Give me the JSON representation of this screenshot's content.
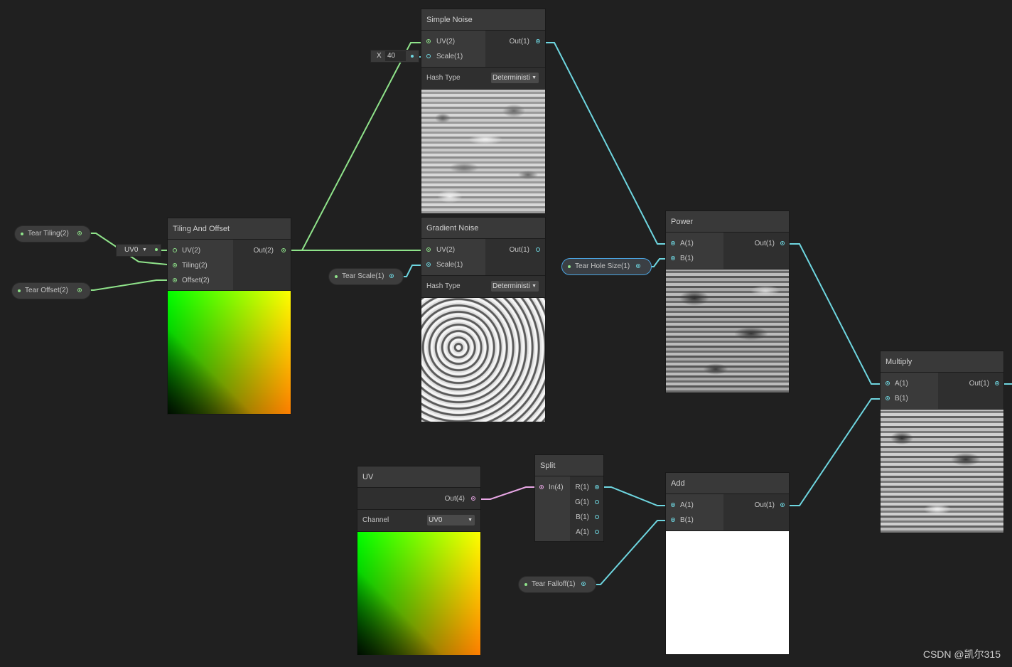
{
  "nodes": {
    "simple_noise": {
      "title": "Simple Noise",
      "inputs": [
        "UV(2)",
        "Scale(1)"
      ],
      "output": "Out(1)",
      "hash_label": "Hash Type",
      "hash_value": "Deterministi",
      "scale_field": {
        "axis": "X",
        "value": "40"
      }
    },
    "gradient_noise": {
      "title": "Gradient Noise",
      "inputs": [
        "UV(2)",
        "Scale(1)"
      ],
      "output": "Out(1)",
      "hash_label": "Hash Type",
      "hash_value": "Deterministi"
    },
    "tiling_offset": {
      "title": "Tiling And Offset",
      "inputs": [
        "UV(2)",
        "Tiling(2)",
        "Offset(2)"
      ],
      "output": "Out(2)",
      "uv_dropdown": "UV0"
    },
    "power": {
      "title": "Power",
      "inputs": [
        "A(1)",
        "B(1)"
      ],
      "output": "Out(1)"
    },
    "multiply": {
      "title": "Multiply",
      "inputs": [
        "A(1)",
        "B(1)"
      ],
      "output": "Out(1)"
    },
    "uv": {
      "title": "UV",
      "output": "Out(4)",
      "channel_label": "Channel",
      "channel_value": "UV0"
    },
    "split": {
      "title": "Split",
      "input": "In(4)",
      "outputs": [
        "R(1)",
        "G(1)",
        "B(1)",
        "A(1)"
      ]
    },
    "add": {
      "title": "Add",
      "inputs": [
        "A(1)",
        "B(1)"
      ],
      "output": "Out(1)"
    }
  },
  "properties": {
    "tear_tiling": "Tear Tiling(2)",
    "tear_offset": "Tear Offset(2)",
    "tear_scale": "Tear Scale(1)",
    "tear_hole_size": "Tear Hole Size(1)",
    "tear_falloff": "Tear Falloff(1)"
  },
  "colors": {
    "vector2_port": "#8fe38a",
    "float_port": "#6ed6e0",
    "vector4_port": "#e9a7e6",
    "selection": "#4aa3df",
    "background": "#202020"
  },
  "watermark": "CSDN @凯尔315"
}
